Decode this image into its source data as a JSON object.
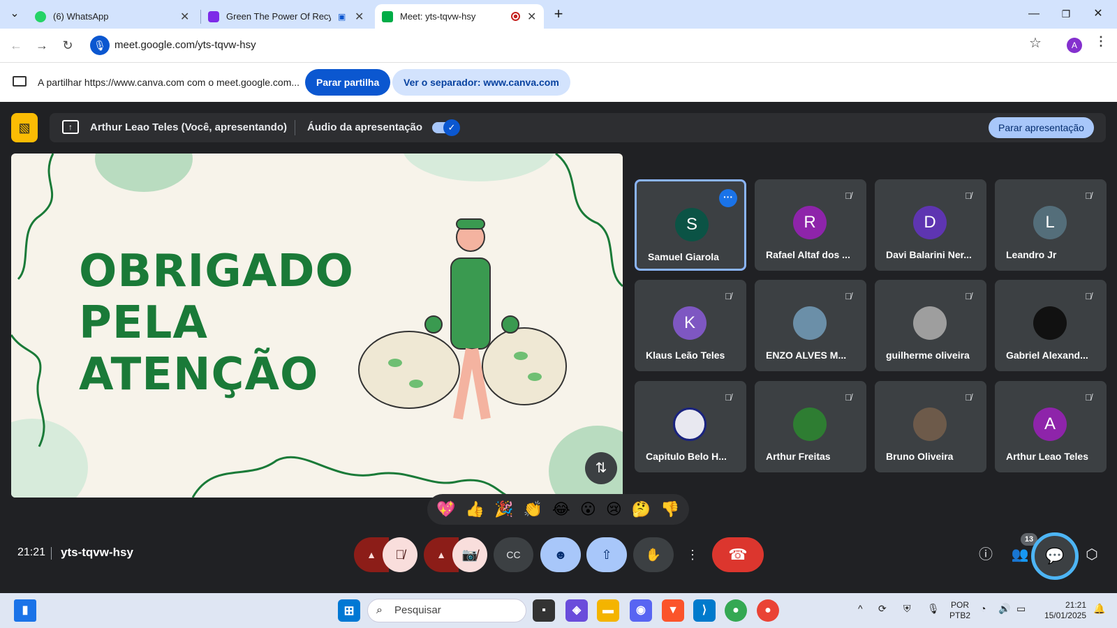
{
  "browser": {
    "tabs": [
      {
        "title": "(6) WhatsApp",
        "favicon_color": "#25d366"
      },
      {
        "title": "Green The Power Of Recycl",
        "favicon_color": "#7d2ae8"
      },
      {
        "title": "Meet: yts-tqvw-hsy",
        "favicon_color": "#00ac47",
        "active": true
      }
    ],
    "new_tab_label": "+",
    "url": "meet.google.com/yts-tqvw-hsy",
    "profile_initial": "A"
  },
  "share_bar": {
    "message": "A partilhar https://www.canva.com com o meet.google.com...",
    "stop_label": "Parar partilha",
    "view_label": "Ver o separador: www.canva.com"
  },
  "presentation": {
    "presenter": "Arthur Leao Teles (Você, apresentando)",
    "audio_label": "Áudio da apresentação",
    "audio_enabled": true,
    "stop_label": "Parar apresentação"
  },
  "slide": {
    "heading_lines": [
      "OBRIGADO",
      "PELA",
      "ATENÇÃO"
    ],
    "heading_color": "#1a7a38"
  },
  "participants": [
    {
      "name": "Samuel Giarola",
      "initial": "S",
      "color": "#0b5345",
      "active": true
    },
    {
      "name": "Rafael Altaf dos ...",
      "initial": "R",
      "color": "#8e24aa"
    },
    {
      "name": "Davi Balarini Ner...",
      "initial": "D",
      "color": "#5e35b1"
    },
    {
      "name": "Leandro Jr",
      "initial": "L",
      "color": "#546e7a"
    },
    {
      "name": "Klaus Leão Teles",
      "initial": "K",
      "color": "#7e57c2"
    },
    {
      "name": "ENZO ALVES M...",
      "initial": "",
      "color": "#6b8fa8",
      "photo": true
    },
    {
      "name": "guilherme oliveira",
      "initial": "",
      "color": "#9e9e9e",
      "photo": true
    },
    {
      "name": "Gabriel Alexand...",
      "initial": "",
      "color": "#111111",
      "photo": true
    },
    {
      "name": "Capitulo Belo H...",
      "initial": "",
      "color": "#e8e8f0",
      "photo": true
    },
    {
      "name": "Arthur Freitas",
      "initial": "",
      "color": "#2e7d32",
      "photo": true
    },
    {
      "name": "Bruno Oliveira",
      "initial": "",
      "color": "#6d5a4a",
      "photo": true
    },
    {
      "name": "Arthur Leao Teles",
      "initial": "A",
      "color": "#8e24aa"
    }
  ],
  "reactions": [
    "💖",
    "👍",
    "🎉",
    "👏",
    "😂",
    "😮",
    "😢",
    "🤔",
    "👎"
  ],
  "meeting": {
    "time": "21:21",
    "code": "yts-tqvw-hsy",
    "participant_count": "13"
  },
  "taskbar": {
    "search_placeholder": "Pesquisar",
    "lang_line1": "POR",
    "lang_line2": "PTB2",
    "time": "21:21",
    "date": "15/01/2025"
  }
}
